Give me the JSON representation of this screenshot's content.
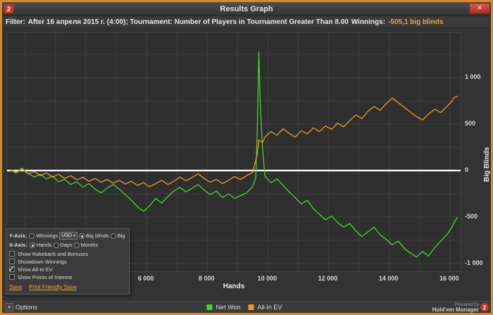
{
  "window": {
    "title": "Results Graph",
    "app_badge": "2",
    "close_glyph": "✕"
  },
  "filter_bar": {
    "prefix": "Filter:",
    "text": "After 16 апреля 2015 г. (4:00); Tournament: Number of Players in Tournament Greater Than 8.00",
    "winnings_label": "Winnings:",
    "winnings_value": "-505,1 big blinds"
  },
  "chart_data": {
    "type": "line",
    "title": "",
    "xlabel": "Hands",
    "ylabel": "Big Blinds",
    "xlim": [
      1400,
      16400
    ],
    "ylim": [
      -1100,
      1480
    ],
    "x_grid_step": 1000,
    "y_grid_step": 250,
    "grid": true,
    "zero_line": true,
    "legend_position": "bottom-center",
    "x_ticks": [
      {
        "value": 6000,
        "label": "6 000"
      },
      {
        "value": 8000,
        "label": "8 000"
      },
      {
        "value": 10000,
        "label": "10 000"
      },
      {
        "value": 12000,
        "label": "12 000"
      },
      {
        "value": 14000,
        "label": "14 000"
      },
      {
        "value": 16000,
        "label": "16 000"
      }
    ],
    "y_ticks": [
      {
        "value": 1000,
        "label": "1 000"
      },
      {
        "value": 500,
        "label": "500"
      },
      {
        "value": 0,
        "label": "0"
      },
      {
        "value": -500,
        "label": "-500"
      },
      {
        "value": -1000,
        "label": "-1 000"
      }
    ],
    "series": [
      {
        "name": "Net Won",
        "color": "#44d62c",
        "points": [
          [
            1500,
            10
          ],
          [
            1700,
            -15
          ],
          [
            1900,
            25
          ],
          [
            2100,
            -30
          ],
          [
            2300,
            -70
          ],
          [
            2500,
            -40
          ],
          [
            2700,
            -90
          ],
          [
            2900,
            -60
          ],
          [
            3100,
            -120
          ],
          [
            3300,
            -95
          ],
          [
            3500,
            -150
          ],
          [
            3700,
            -120
          ],
          [
            3900,
            -180
          ],
          [
            4100,
            -140
          ],
          [
            4300,
            -200
          ],
          [
            4500,
            -240
          ],
          [
            4700,
            -190
          ],
          [
            4900,
            -150
          ],
          [
            5100,
            -200
          ],
          [
            5300,
            -260
          ],
          [
            5500,
            -320
          ],
          [
            5700,
            -390
          ],
          [
            5900,
            -440
          ],
          [
            6100,
            -380
          ],
          [
            6300,
            -300
          ],
          [
            6500,
            -350
          ],
          [
            6700,
            -280
          ],
          [
            6900,
            -220
          ],
          [
            7100,
            -180
          ],
          [
            7300,
            -230
          ],
          [
            7500,
            -190
          ],
          [
            7700,
            -150
          ],
          [
            7900,
            -210
          ],
          [
            8100,
            -260
          ],
          [
            8300,
            -220
          ],
          [
            8500,
            -290
          ],
          [
            8700,
            -250
          ],
          [
            8900,
            -300
          ],
          [
            9100,
            -270
          ],
          [
            9300,
            -240
          ],
          [
            9500,
            -170
          ],
          [
            9600,
            -80
          ],
          [
            9650,
            420
          ],
          [
            9700,
            1280
          ],
          [
            9750,
            700
          ],
          [
            9820,
            260
          ],
          [
            9900,
            -60
          ],
          [
            10100,
            -130
          ],
          [
            10300,
            -90
          ],
          [
            10500,
            -160
          ],
          [
            10700,
            -230
          ],
          [
            10900,
            -290
          ],
          [
            11100,
            -360
          ],
          [
            11300,
            -320
          ],
          [
            11500,
            -410
          ],
          [
            11700,
            -470
          ],
          [
            11900,
            -530
          ],
          [
            12100,
            -490
          ],
          [
            12300,
            -560
          ],
          [
            12500,
            -610
          ],
          [
            12700,
            -570
          ],
          [
            12900,
            -650
          ],
          [
            13100,
            -710
          ],
          [
            13300,
            -660
          ],
          [
            13500,
            -610
          ],
          [
            13700,
            -690
          ],
          [
            13900,
            -740
          ],
          [
            14100,
            -800
          ],
          [
            14300,
            -760
          ],
          [
            14500,
            -840
          ],
          [
            14700,
            -890
          ],
          [
            14900,
            -930
          ],
          [
            15100,
            -870
          ],
          [
            15300,
            -920
          ],
          [
            15500,
            -830
          ],
          [
            15700,
            -760
          ],
          [
            15900,
            -690
          ],
          [
            16050,
            -620
          ],
          [
            16150,
            -550
          ],
          [
            16250,
            -505
          ]
        ]
      },
      {
        "name": "All-In EV",
        "color": "#f79522",
        "points": [
          [
            1500,
            5
          ],
          [
            1700,
            -25
          ],
          [
            1900,
            15
          ],
          [
            2100,
            -35
          ],
          [
            2300,
            -10
          ],
          [
            2500,
            -55
          ],
          [
            2700,
            -25
          ],
          [
            2900,
            -70
          ],
          [
            3100,
            -40
          ],
          [
            3300,
            -85
          ],
          [
            3500,
            -55
          ],
          [
            3700,
            -100
          ],
          [
            3900,
            -70
          ],
          [
            4100,
            -115
          ],
          [
            4300,
            -85
          ],
          [
            4500,
            -125
          ],
          [
            4700,
            -95
          ],
          [
            4900,
            -135
          ],
          [
            5100,
            -105
          ],
          [
            5300,
            -145
          ],
          [
            5500,
            -115
          ],
          [
            5700,
            -160
          ],
          [
            5900,
            -130
          ],
          [
            6100,
            -175
          ],
          [
            6300,
            -140
          ],
          [
            6500,
            -105
          ],
          [
            6700,
            -150
          ],
          [
            6900,
            -115
          ],
          [
            7100,
            -70
          ],
          [
            7300,
            -110
          ],
          [
            7500,
            -75
          ],
          [
            7700,
            -35
          ],
          [
            7900,
            -85
          ],
          [
            8100,
            -125
          ],
          [
            8300,
            -95
          ],
          [
            8500,
            -140
          ],
          [
            8700,
            -105
          ],
          [
            8900,
            -65
          ],
          [
            9100,
            -95
          ],
          [
            9300,
            -55
          ],
          [
            9500,
            -20
          ],
          [
            9650,
            180
          ],
          [
            9700,
            330
          ],
          [
            9820,
            300
          ],
          [
            9900,
            360
          ],
          [
            10100,
            420
          ],
          [
            10300,
            380
          ],
          [
            10500,
            450
          ],
          [
            10700,
            400
          ],
          [
            10900,
            360
          ],
          [
            11100,
            430
          ],
          [
            11300,
            395
          ],
          [
            11500,
            460
          ],
          [
            11700,
            420
          ],
          [
            11900,
            480
          ],
          [
            12100,
            445
          ],
          [
            12300,
            510
          ],
          [
            12500,
            470
          ],
          [
            12700,
            540
          ],
          [
            12900,
            600
          ],
          [
            13100,
            560
          ],
          [
            13300,
            640
          ],
          [
            13500,
            690
          ],
          [
            13700,
            650
          ],
          [
            13900,
            720
          ],
          [
            14100,
            780
          ],
          [
            14300,
            730
          ],
          [
            14500,
            680
          ],
          [
            14700,
            630
          ],
          [
            14900,
            580
          ],
          [
            15100,
            545
          ],
          [
            15300,
            610
          ],
          [
            15500,
            660
          ],
          [
            15700,
            625
          ],
          [
            15900,
            690
          ],
          [
            16050,
            740
          ],
          [
            16150,
            790
          ],
          [
            16250,
            800
          ]
        ]
      }
    ]
  },
  "options_panel": {
    "y_axis_label": "Y-Axis:",
    "x_axis_label": "X-Axis:",
    "currency": "USD",
    "y_axis_options": [
      {
        "label": "Winnings",
        "selected": false
      },
      {
        "label": "Big blinds",
        "selected": true
      },
      {
        "label": "Big bets",
        "selected": false
      }
    ],
    "x_axis_options": [
      {
        "label": "Hands",
        "selected": true
      },
      {
        "label": "Days",
        "selected": false
      },
      {
        "label": "Months",
        "selected": false
      }
    ],
    "checkboxes": [
      {
        "label": "Show Rakeback and Bonuses",
        "checked": false
      },
      {
        "label": "Showdown Winnings",
        "checked": false
      },
      {
        "label": "Show All-In EV",
        "checked": true
      },
      {
        "label": "Show Points of Interest",
        "checked": false
      }
    ],
    "links": {
      "save": "Save",
      "print": "Print Friendly Save"
    }
  },
  "footer": {
    "options_label": "Options",
    "powered_by": "Powered by",
    "brand": "Hold'em Manager",
    "badge": "2"
  },
  "colors": {
    "window_border": "#d9892b",
    "zero_line": "#ffffff",
    "badge_red": "#c43b2a",
    "link_orange": "#f0a23c"
  }
}
